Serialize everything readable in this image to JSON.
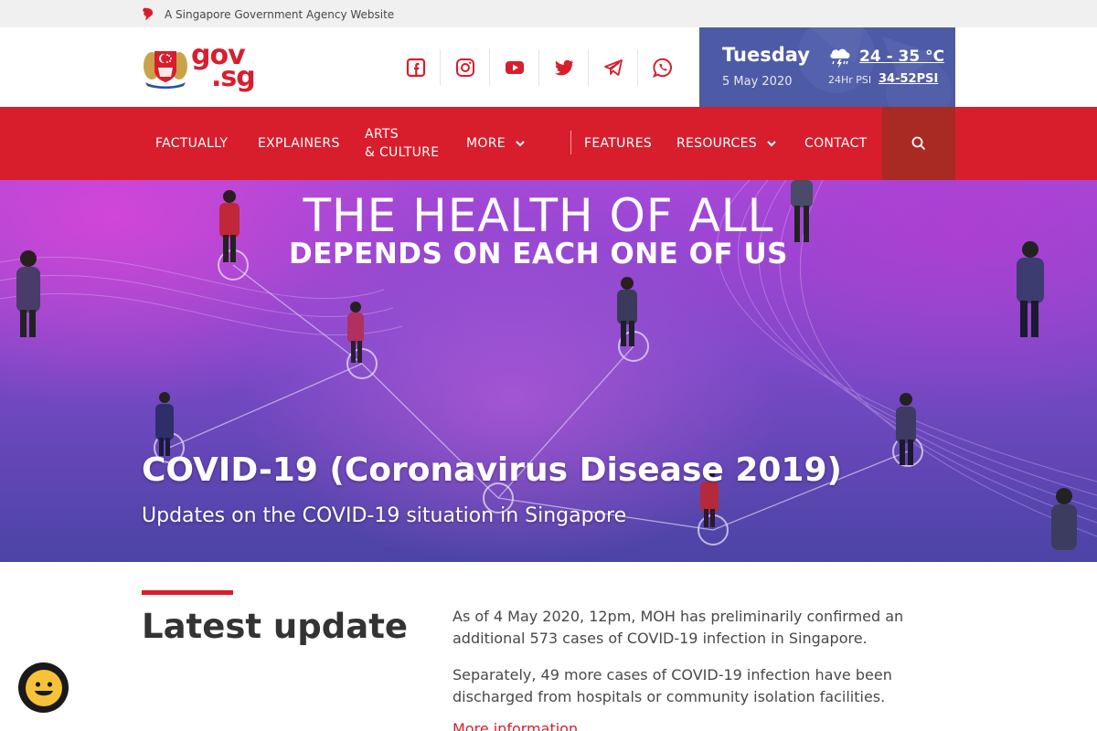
{
  "masthead": {
    "text": "A Singapore Government Agency Website",
    "icon": "lion-head-icon"
  },
  "logo": {
    "text_top": "gov",
    "text_bottom": ".sg",
    "crest": "singapore-crest-icon"
  },
  "socials": [
    {
      "name": "facebook-icon"
    },
    {
      "name": "instagram-icon"
    },
    {
      "name": "youtube-icon"
    },
    {
      "name": "twitter-icon"
    },
    {
      "name": "telegram-icon"
    },
    {
      "name": "whatsapp-icon"
    }
  ],
  "datebox": {
    "day": "Tuesday",
    "date": "5 May 2020",
    "weather_icon": "thundery-showers-icon",
    "temperature": "24 - 35 °C",
    "psi_label": "24Hr PSI",
    "psi_value": "34-52PSI"
  },
  "nav": {
    "items": [
      {
        "label": "FACTUALLY"
      },
      {
        "label": "EXPLAINERS"
      },
      {
        "label_line1": "ARTS",
        "label_line2": "& CULTURE"
      },
      {
        "label": "MORE"
      },
      {
        "label": "FEATURES"
      },
      {
        "label": "RESOURCES"
      },
      {
        "label": "CONTACT"
      }
    ],
    "search_icon": "search-icon"
  },
  "hero": {
    "line1": "THE HEALTH OF ALL",
    "line2": "DEPENDS ON EACH ONE OF US",
    "title": "COVID-19 (Coronavirus Disease 2019)",
    "subtitle": "Updates on the COVID-19 situation in Singapore"
  },
  "content": {
    "heading": "Latest update",
    "paragraph1": "As of 4 May 2020, 12pm, MOH has preliminarily confirmed an additional 573 cases of COVID-19 infection in Singapore.",
    "paragraph2": "Separately, 49 more cases of COVID-19 infection have been discharged from hospitals or community isolation facilities.",
    "more_link": "More information"
  },
  "colors": {
    "brand_red": "#d81e2d",
    "datebox_blue": "#4d5aa5",
    "search_dark_red": "#a82a22",
    "masthead_grey": "#f0f0f0"
  },
  "chatbot": {
    "icon": "smiley-face-icon"
  }
}
